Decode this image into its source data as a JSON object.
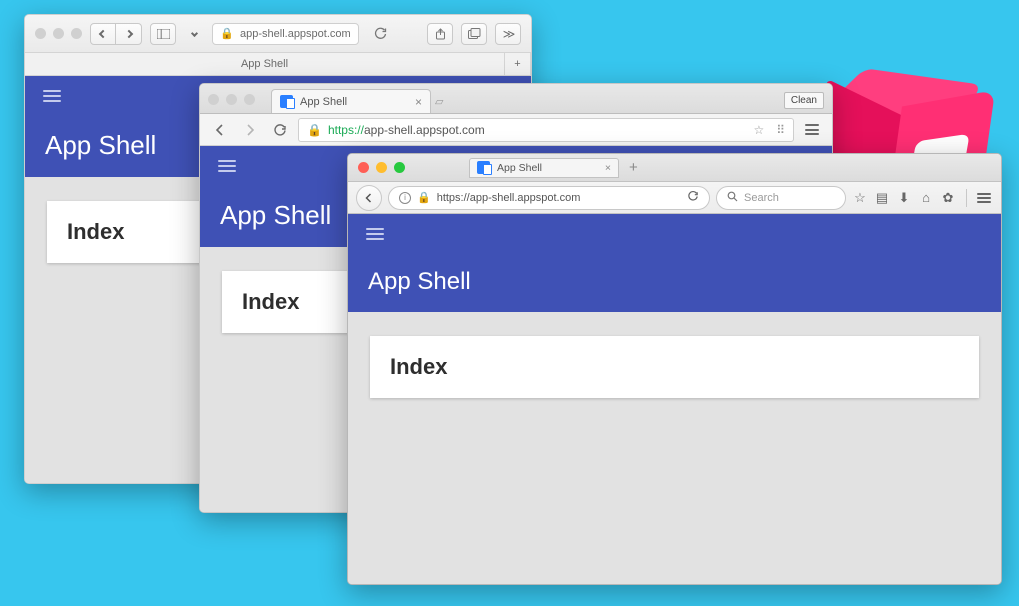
{
  "app": {
    "title": "App Shell",
    "card_heading": "Index"
  },
  "safari": {
    "address_text": "app-shell.appspot.com",
    "tab_title": "App Shell"
  },
  "chrome": {
    "tab_title": "App Shell",
    "clean_label": "Clean",
    "omnibox_scheme": "https://",
    "omnibox_host_path": "app-shell.appspot.com"
  },
  "firefox": {
    "tab_title": "App Shell",
    "url_text": "https://app-shell.appspot.com",
    "search_placeholder": "Search"
  }
}
